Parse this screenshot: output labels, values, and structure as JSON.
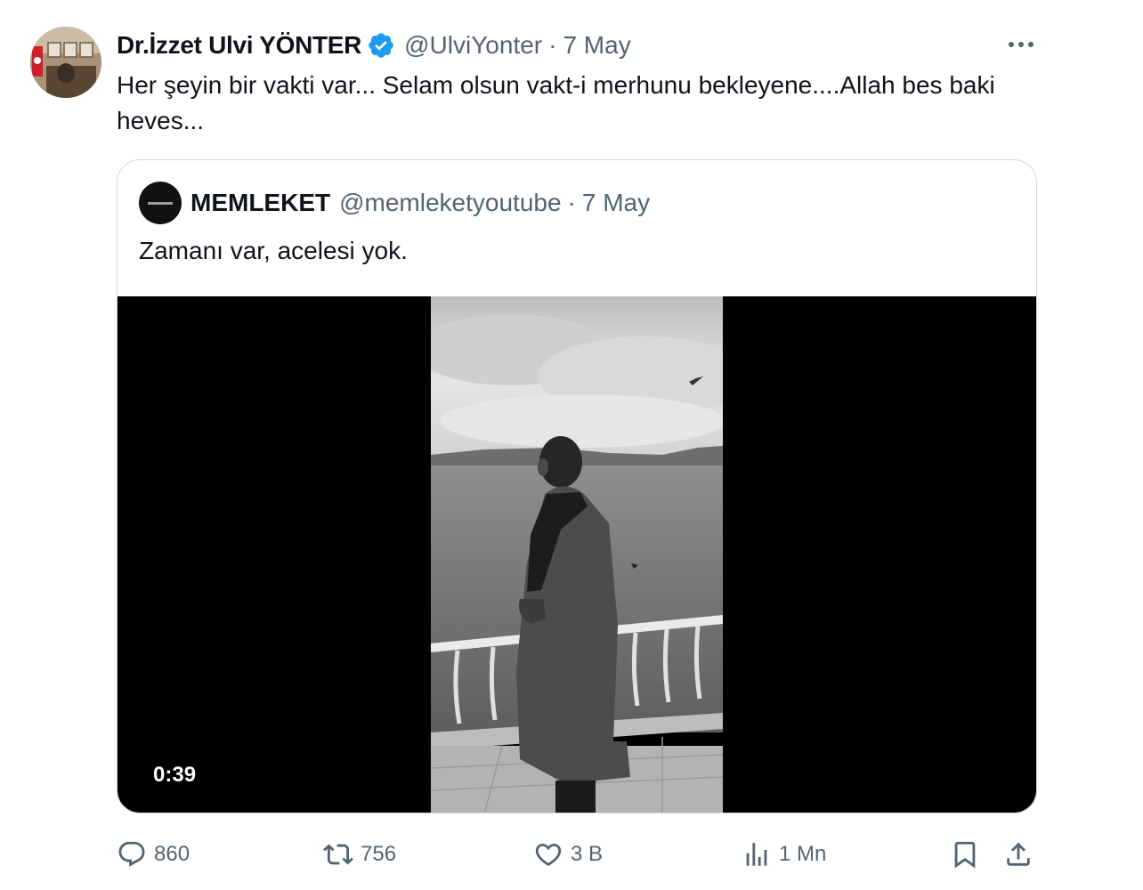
{
  "tweet": {
    "author_name": "Dr.İzzet Ulvi YÖNTER",
    "handle": "@UlviYonter",
    "separator": "·",
    "date": "7 May",
    "text": "Her şeyin bir vakti var... Selam olsun vakt-i merhunu bekleyene....Allah bes baki heves...",
    "verified": true,
    "verified_color": "#1d9bf0"
  },
  "quoted_tweet": {
    "author_name": "MEMLEKET",
    "handle": "@memleketyoutube",
    "separator": "·",
    "date": "7 May",
    "text": "Zamanı var, acelesi yok.",
    "video": {
      "duration": "0:39"
    }
  },
  "actions": {
    "replies": "860",
    "reposts": "756",
    "likes": "3 B",
    "views": "1 Mn"
  },
  "icons": {
    "more": "more-icon",
    "reply": "reply-icon",
    "repost": "repost-icon",
    "like": "heart-icon",
    "views": "views-icon",
    "bookmark": "bookmark-icon",
    "share": "share-icon"
  },
  "colors": {
    "text_primary": "#0f1419",
    "text_secondary": "#536471",
    "border": "#cfd9de"
  }
}
